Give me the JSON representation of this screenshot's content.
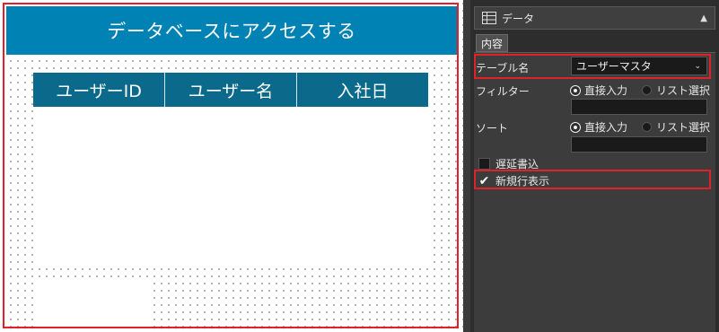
{
  "canvas": {
    "header_title": "データベースにアクセスする",
    "table_columns": [
      "ユーザーID",
      "ユーザー名",
      "入社日"
    ]
  },
  "panel": {
    "title": "データ",
    "collapse_icon": "▲",
    "tab": "内容",
    "table_name_label": "テーブル名",
    "table_name_value": "ユーザーマスタ",
    "filter_label": "フィルター",
    "filter_option_direct": "直接入力",
    "filter_option_list": "リスト選択",
    "sort_label": "ソート",
    "sort_option_direct": "直接入力",
    "sort_option_list": "リスト選択",
    "delayed_write_label": "遅延書込",
    "new_row_label": "新規行表示",
    "checkmark": "✔"
  }
}
